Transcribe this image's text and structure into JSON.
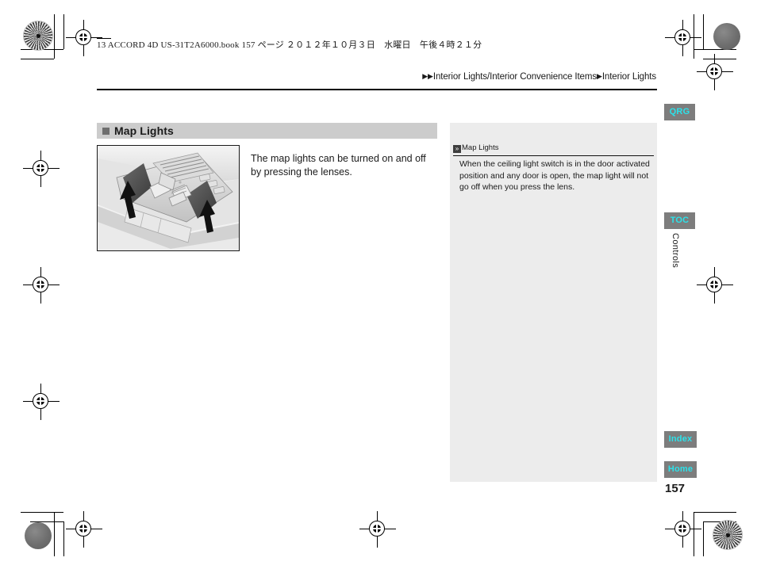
{
  "print_header": {
    "book_info": "13 ACCORD 4D US-31T2A6000.book   157 ページ   ２０１２年１０月３日　水曜日　午後４時２１分"
  },
  "breadcrumb": {
    "arrow_double": "▶▶",
    "parent": "Interior Lights/Interior Convenience Items",
    "arrow_single": "▶",
    "current": "Interior Lights"
  },
  "section": {
    "bullet_icon": "filled-square-icon",
    "title": "Map Lights"
  },
  "figure": {
    "name": "overhead-console-map-lights-illustration",
    "caption": ""
  },
  "body": {
    "paragraph": "The map lights can be turned on and off by pressing the lenses."
  },
  "note": {
    "icon": "double-chevron-icon",
    "icon_glyph": "»",
    "heading": "Map Lights",
    "text": "When the ceiling light switch is in the door activated position and any door is open, the map light will not go off when you press the lens."
  },
  "tabs": [
    {
      "id": "qrg",
      "label": "QRG"
    },
    {
      "id": "toc",
      "label": "TOC"
    },
    {
      "id": "index",
      "label": "Index"
    },
    {
      "id": "home",
      "label": "Home"
    }
  ],
  "side_chapter": "Controls",
  "page_number": "157",
  "colors": {
    "tab_background": "#7d7d7d",
    "tab_text": "#2ce2ea",
    "section_band": "#cccccc",
    "section_bullet": "#6e6e6e",
    "note_background": "#ececec",
    "rule": "#000000"
  }
}
